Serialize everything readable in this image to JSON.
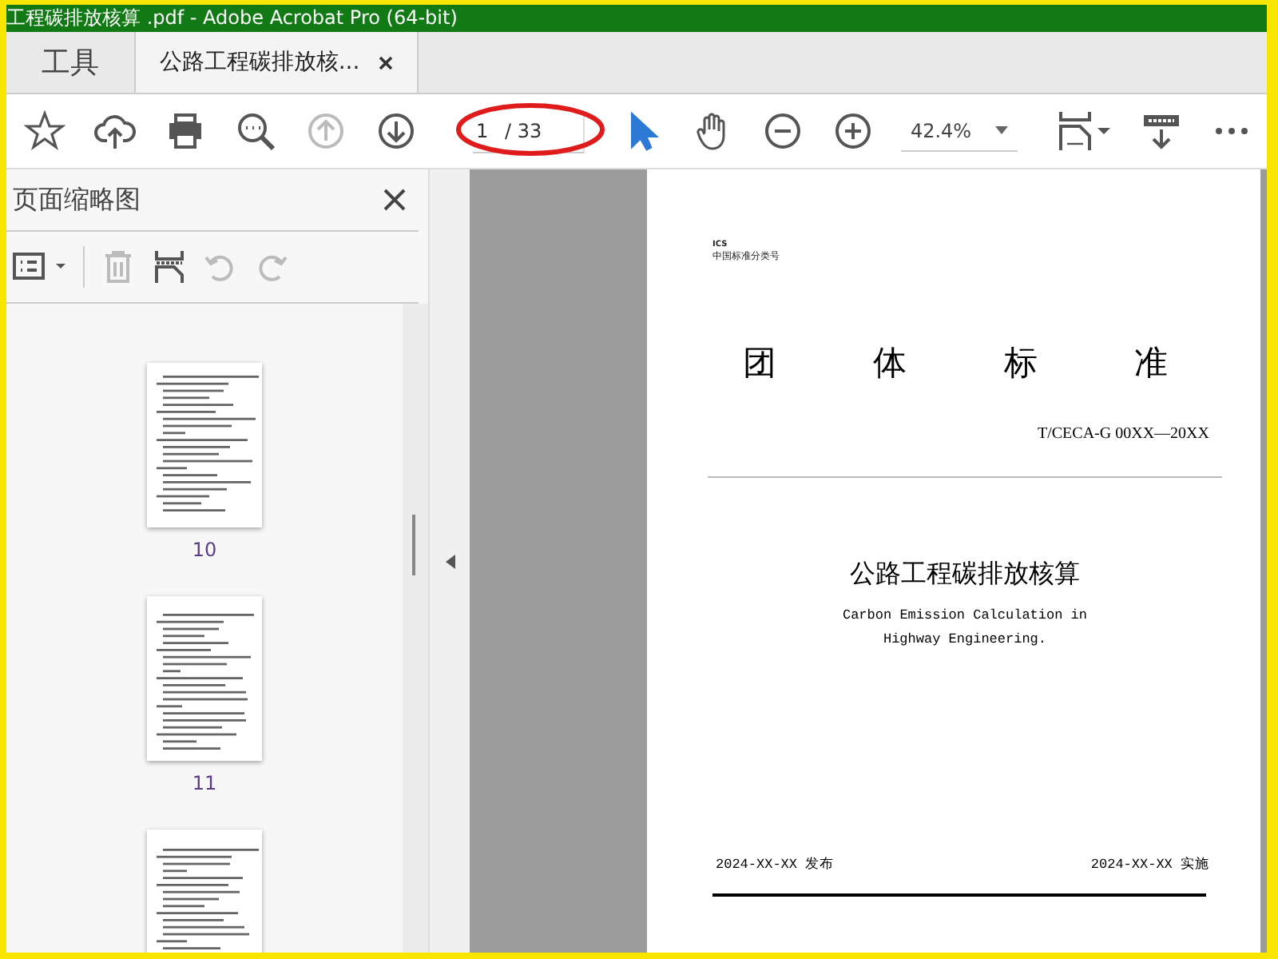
{
  "window": {
    "title": "工程碳排放核算 .pdf - Adobe Acrobat Pro (64-bit)"
  },
  "tabs": [
    {
      "label": "工具",
      "selected": false,
      "closable": false
    },
    {
      "label": "公路工程碳排放核...",
      "selected": true,
      "closable": true
    }
  ],
  "toolbar": [
    {
      "kind": "star",
      "disabled": false
    },
    {
      "kind": "upload",
      "disabled": false
    },
    {
      "kind": "print",
      "disabled": false
    },
    {
      "kind": "find",
      "disabled": false
    },
    {
      "kind": "prev",
      "disabled": true
    },
    {
      "kind": "next",
      "disabled": false
    },
    {
      "kind": "page",
      "value": "1",
      "total": "/ 33",
      "circled": true
    },
    {
      "kind": "select",
      "selected": true
    },
    {
      "kind": "hand",
      "selected": false
    },
    {
      "kind": "zoomout",
      "disabled": false
    },
    {
      "kind": "zoomin",
      "disabled": false
    },
    {
      "kind": "zoom",
      "value": "42.4%"
    },
    {
      "kind": "fit",
      "disabled": false
    },
    {
      "kind": "scroll",
      "disabled": false
    },
    {
      "kind": "more",
      "disabled": false
    }
  ],
  "panel": {
    "title": "页面缩略图",
    "tools": [
      {
        "kind": "options",
        "disabled": false
      },
      {
        "kind": "delete",
        "disabled": true
      },
      {
        "kind": "insert",
        "disabled": false
      },
      {
        "kind": "undo",
        "disabled": true
      },
      {
        "kind": "redo",
        "disabled": true
      }
    ],
    "thumbnails": [
      {
        "label": "10"
      },
      {
        "label": "11"
      }
    ],
    "partial_thumbnail": true
  },
  "document": {
    "ics": "ICS",
    "class_code": "中国标准分类号",
    "heading": "团 体 标 准",
    "code": "T/CECA-G 00XX—20XX",
    "title_cn": "公路工程碳排放核算",
    "title_en": [
      "Carbon Emission Calculation in",
      "Highway Engineering."
    ],
    "issued": "2024-XX-XX 发布",
    "effective": "2024-XX-XX 实施"
  }
}
